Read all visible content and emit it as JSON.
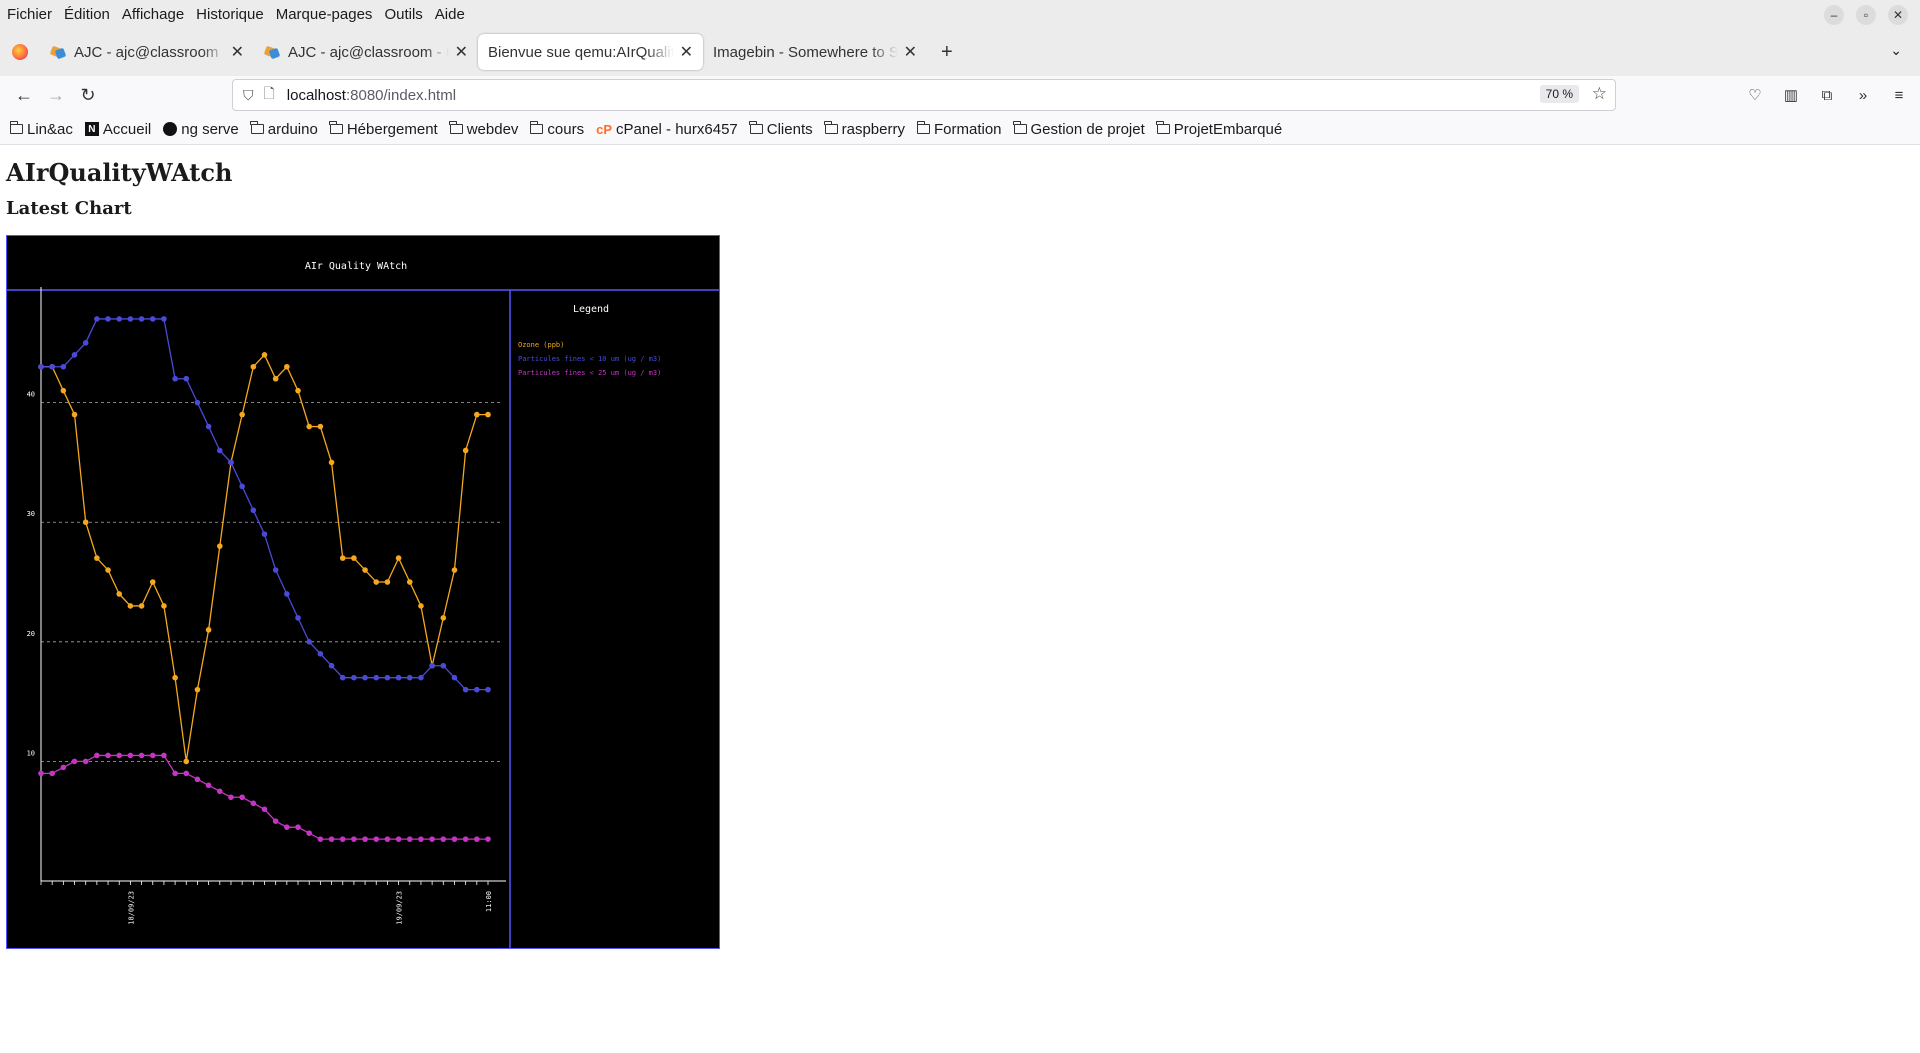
{
  "menu": [
    "Fichier",
    "Édition",
    "Affichage",
    "Historique",
    "Marque-pages",
    "Outils",
    "Aide"
  ],
  "tabs": [
    {
      "title": "AJC - ajc@classroom - Ma",
      "active": false
    },
    {
      "title": "AJC - ajc@classroom - PR",
      "active": false
    },
    {
      "title": "Bienvue sue qemu:AIrQualit",
      "active": true
    },
    {
      "title": "Imagebin - Somewhere to St",
      "active": false
    }
  ],
  "url": {
    "host": "localhost",
    "path": ":8080/index.html"
  },
  "zoom": "70 %",
  "bookmarks": [
    "Lin&ac",
    "Accueil",
    "ng serve",
    "arduino",
    "Hébergement",
    "webdev",
    "cours",
    "cPanel - hurx6457",
    "Clients",
    "raspberry",
    "Formation",
    "Gestion de projet",
    "ProjetEmbarqué"
  ],
  "page": {
    "title": "AIrQualityWAtch",
    "subtitle": "Latest Chart"
  },
  "colors": {
    "ozone": "#f5a81e",
    "pm10": "#4a4ad8",
    "pm25": "#c634c6",
    "frame": "#5555ff"
  },
  "chart_data": {
    "type": "line",
    "title": "AIr Quality WAtch",
    "legend_title": "Legend",
    "legend_position": "right",
    "ylim": [
      0,
      49
    ],
    "yticks": [
      "10",
      "20",
      "30",
      "40"
    ],
    "xticks": [
      "18/09/23",
      "19/09/23",
      "11:00"
    ],
    "series": [
      {
        "name": "Ozone (ppb)",
        "values": [
          43,
          43,
          41,
          39,
          30,
          27,
          26,
          24,
          23,
          23,
          25,
          23,
          17,
          10,
          16,
          21,
          28,
          35,
          39,
          43,
          44,
          42,
          43,
          41,
          38,
          38,
          35,
          27,
          27,
          26,
          25,
          25,
          27,
          25,
          23,
          18,
          22,
          26,
          36,
          39,
          39
        ]
      },
      {
        "name": "Particules fines < 10 um (ug / m3)",
        "values": [
          43,
          43,
          43,
          44,
          45,
          47,
          47,
          47,
          47,
          47,
          47,
          47,
          42,
          42,
          40,
          38,
          36,
          35,
          33,
          31,
          29,
          26,
          24,
          22,
          20,
          19,
          18,
          17,
          17,
          17,
          17,
          17,
          17,
          17,
          17,
          18,
          18,
          17,
          16,
          16,
          16
        ]
      },
      {
        "name": "Particules fines < 25 um (ug / m3)",
        "values": [
          9,
          9,
          9.5,
          10,
          10,
          10.5,
          10.5,
          10.5,
          10.5,
          10.5,
          10.5,
          10.5,
          9,
          9,
          8.5,
          8,
          7.5,
          7,
          7,
          6.5,
          6,
          5,
          4.5,
          4.5,
          4,
          3.5,
          3.5,
          3.5,
          3.5,
          3.5,
          3.5,
          3.5,
          3.5,
          3.5,
          3.5,
          3.5,
          3.5,
          3.5,
          3.5,
          3.5,
          3.5
        ]
      }
    ]
  }
}
